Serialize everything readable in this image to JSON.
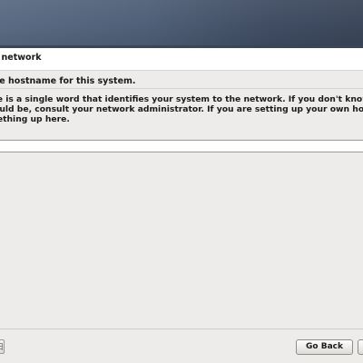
{
  "header": {
    "section_title": "he network"
  },
  "form": {
    "prompt": "r the hostname for this system.",
    "description_lines": [
      "ame is a single word that identifies your system to the network. If you don't know what y",
      "should be, consult your network administrator. If you are setting up your own home netw",
      "omething up here."
    ],
    "hostname_value": ""
  },
  "footer": {
    "screenshot_icon": "grid-icon",
    "back_label": "Go Back",
    "continue_label": ""
  },
  "colors": {
    "banner": "#4f5f77",
    "background": "#edeceb",
    "input_bg": "#ffffff"
  }
}
